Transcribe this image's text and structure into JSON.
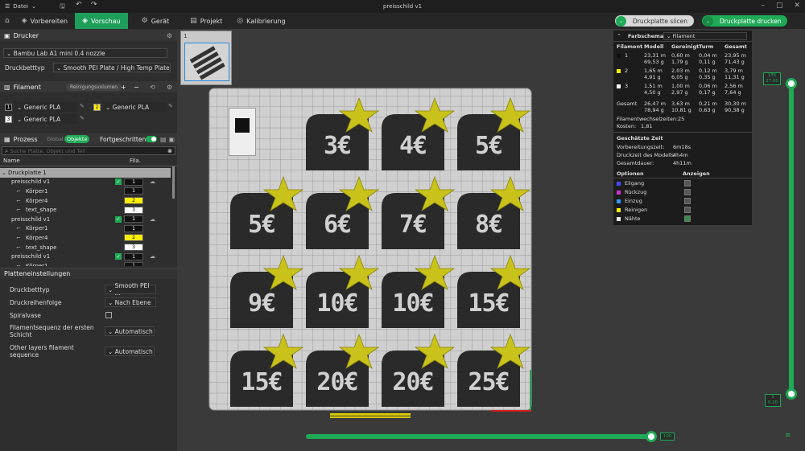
{
  "titlebar": {
    "menu_label": "Datei",
    "title": "preisschild v1"
  },
  "tabs": [
    {
      "label": "Vorbereiten",
      "icon": "cube-icon"
    },
    {
      "label": "Vorschau",
      "icon": "preview-icon"
    },
    {
      "label": "Gerät",
      "icon": "device-icon"
    },
    {
      "label": "Projekt",
      "icon": "project-icon"
    },
    {
      "label": "Kalibrierung",
      "icon": "calibration-icon"
    }
  ],
  "actions": {
    "slice_label": "Druckplatte slicen",
    "print_label": "Druckplatte drucken"
  },
  "printer": {
    "section_label": "Drucker",
    "printer_name": "Bambu Lab A1 mini 0.4 nozzle",
    "plate_type_label": "Druckbetttyp",
    "plate_type_value": "Smooth PEI Plate / High Temp Plate"
  },
  "filament": {
    "section_label": "Filament",
    "purge_label": "Reinigungsvolumen",
    "items": [
      {
        "num": "1",
        "name": "Generic PLA",
        "color": "#111111",
        "text_color": "#ffffff"
      },
      {
        "num": "2",
        "name": "Generic PLA",
        "color": "#ffee00",
        "text_color": "#000000"
      },
      {
        "num": "3",
        "name": "Generic PLA",
        "color": "#ffffff",
        "text_color": "#000000"
      }
    ]
  },
  "process": {
    "section_label": "Prozess",
    "global_label": "Global",
    "objects_label": "Objekte",
    "advanced_label": "Fortgeschritten",
    "search_placeholder": "Suche Platte, Objekt und Teil",
    "col_name": "Name",
    "col_fila": "Fila."
  },
  "tree": [
    {
      "name": "Druckplatte 1",
      "level": 0,
      "type": "plate"
    },
    {
      "name": "preisschild v1",
      "level": 1,
      "type": "object",
      "fila": "1",
      "fcolor": "#111111",
      "ftext": "#ffffff"
    },
    {
      "name": "Körper1",
      "level": 2,
      "type": "part",
      "fila": "1",
      "fcolor": "#111111",
      "ftext": "#ffffff"
    },
    {
      "name": "Körper4",
      "level": 2,
      "type": "part",
      "fila": "2",
      "fcolor": "#ffee00",
      "ftext": "#000000"
    },
    {
      "name": "text_shape",
      "level": 2,
      "type": "part",
      "fila": "3",
      "fcolor": "#ffffff",
      "ftext": "#000000"
    },
    {
      "name": "preisschild v1",
      "level": 1,
      "type": "object",
      "fila": "1",
      "fcolor": "#111111",
      "ftext": "#ffffff"
    },
    {
      "name": "Körper1",
      "level": 2,
      "type": "part",
      "fila": "1",
      "fcolor": "#111111",
      "ftext": "#ffffff"
    },
    {
      "name": "Körper4",
      "level": 2,
      "type": "part",
      "fila": "2",
      "fcolor": "#ffee00",
      "ftext": "#000000"
    },
    {
      "name": "text_shape",
      "level": 2,
      "type": "part",
      "fila": "3",
      "fcolor": "#ffffff",
      "ftext": "#000000"
    },
    {
      "name": "preisschild v1",
      "level": 1,
      "type": "object",
      "fila": "1",
      "fcolor": "#111111",
      "ftext": "#ffffff"
    },
    {
      "name": "Körper1",
      "level": 2,
      "type": "part",
      "fila": "1",
      "fcolor": "#111111",
      "ftext": "#ffffff"
    }
  ],
  "plate_settings": {
    "section_label": "Platteneinstellungen",
    "rows": [
      {
        "label": "Druckbetttyp",
        "value": "Smooth PEI ...",
        "kind": "select"
      },
      {
        "label": "Druckreihenfolge",
        "value": "Nach Ebene",
        "kind": "select"
      },
      {
        "label": "Spiralvase",
        "value": "",
        "kind": "checkbox"
      },
      {
        "label": "Filamentsequenz der ersten Schicht",
        "value": "Automatisch",
        "kind": "select"
      },
      {
        "label": "Other layers filament sequence",
        "value": "Automatisch",
        "kind": "select"
      }
    ]
  },
  "plate_thumb": {
    "number": "1"
  },
  "tags": [
    "3€",
    "4€",
    "5€",
    "5€",
    "6€",
    "7€",
    "8€",
    "9€",
    "10€",
    "10€",
    "15€",
    "15€",
    "20€",
    "20€",
    "25€"
  ],
  "colors": {
    "accent": "#1faa56",
    "star": "#c8c21a",
    "tag": "#2a2a2a",
    "tagtext": "#d0d0d0"
  },
  "stats": {
    "colorscheme_label": "Farbschema",
    "colorscheme_value": "Filament",
    "headers": [
      "Filament",
      "Modell",
      "Gereinigt",
      "Turm",
      "Gesamt"
    ],
    "rows": [
      {
        "id": "1",
        "color": "#111111",
        "modell": [
          "23,31 m",
          "69,53 g"
        ],
        "gereinigt": [
          "0,60 m",
          "1,79 g"
        ],
        "turm": [
          "0,04 m",
          "0,11 g"
        ],
        "gesamt": [
          "23,95 m",
          "71,43 g"
        ]
      },
      {
        "id": "2",
        "color": "#ffee00",
        "modell": [
          "1,65 m",
          "4,91 g"
        ],
        "gereinigt": [
          "2,03 m",
          "6,05 g"
        ],
        "turm": [
          "0,12 m",
          "0,35 g"
        ],
        "gesamt": [
          "3,79 m",
          "11,31 g"
        ]
      },
      {
        "id": "3",
        "color": "#ffffff",
        "modell": [
          "1,51 m",
          "4,50 g"
        ],
        "gereinigt": [
          "1,00 m",
          "2,97 g"
        ],
        "turm": [
          "0,06 m",
          "0,17 g"
        ],
        "gesamt": [
          "2,56 m",
          "7,64 g"
        ]
      }
    ],
    "total": {
      "label": "Gesamt",
      "modell": [
        "26,47 m",
        "78,94 g"
      ],
      "gereinigt": [
        "3,63 m",
        "10,81 g"
      ],
      "turm": [
        "0,21 m",
        "0,63 g"
      ],
      "gesamt": [
        "30,30 m",
        "90,38 g"
      ]
    },
    "changes_label": "Filamentwechselzeiten:",
    "changes_value": "25",
    "cost_label": "Kosten:",
    "cost_value": "1,81",
    "est_time_title": "Geschätzte Zeit",
    "times": [
      {
        "label": "Vorbereitungszeit:",
        "value": "6m18s"
      },
      {
        "label": "Druckzeit des Modells:",
        "value": "4h4m"
      },
      {
        "label": "Gesamtdauer:",
        "value": "4h11m"
      }
    ],
    "options_title": "Optionen",
    "show_title": "Anzeigen",
    "options": [
      {
        "label": "Eilgang",
        "color": "#4a4aff",
        "checked": false
      },
      {
        "label": "Rückzug",
        "color": "#cc33cc",
        "checked": false
      },
      {
        "label": "Einzug",
        "color": "#3399ff",
        "checked": false
      },
      {
        "label": "Reinigen",
        "color": "#ffee00",
        "checked": false
      },
      {
        "label": "Nähte",
        "color": "#eeeeee",
        "checked": true
      }
    ]
  },
  "layer_slider": {
    "top_value": "135",
    "top_height": "27.00",
    "bottom_value": "1",
    "bottom_height": "0.20",
    "h_value": "100"
  }
}
